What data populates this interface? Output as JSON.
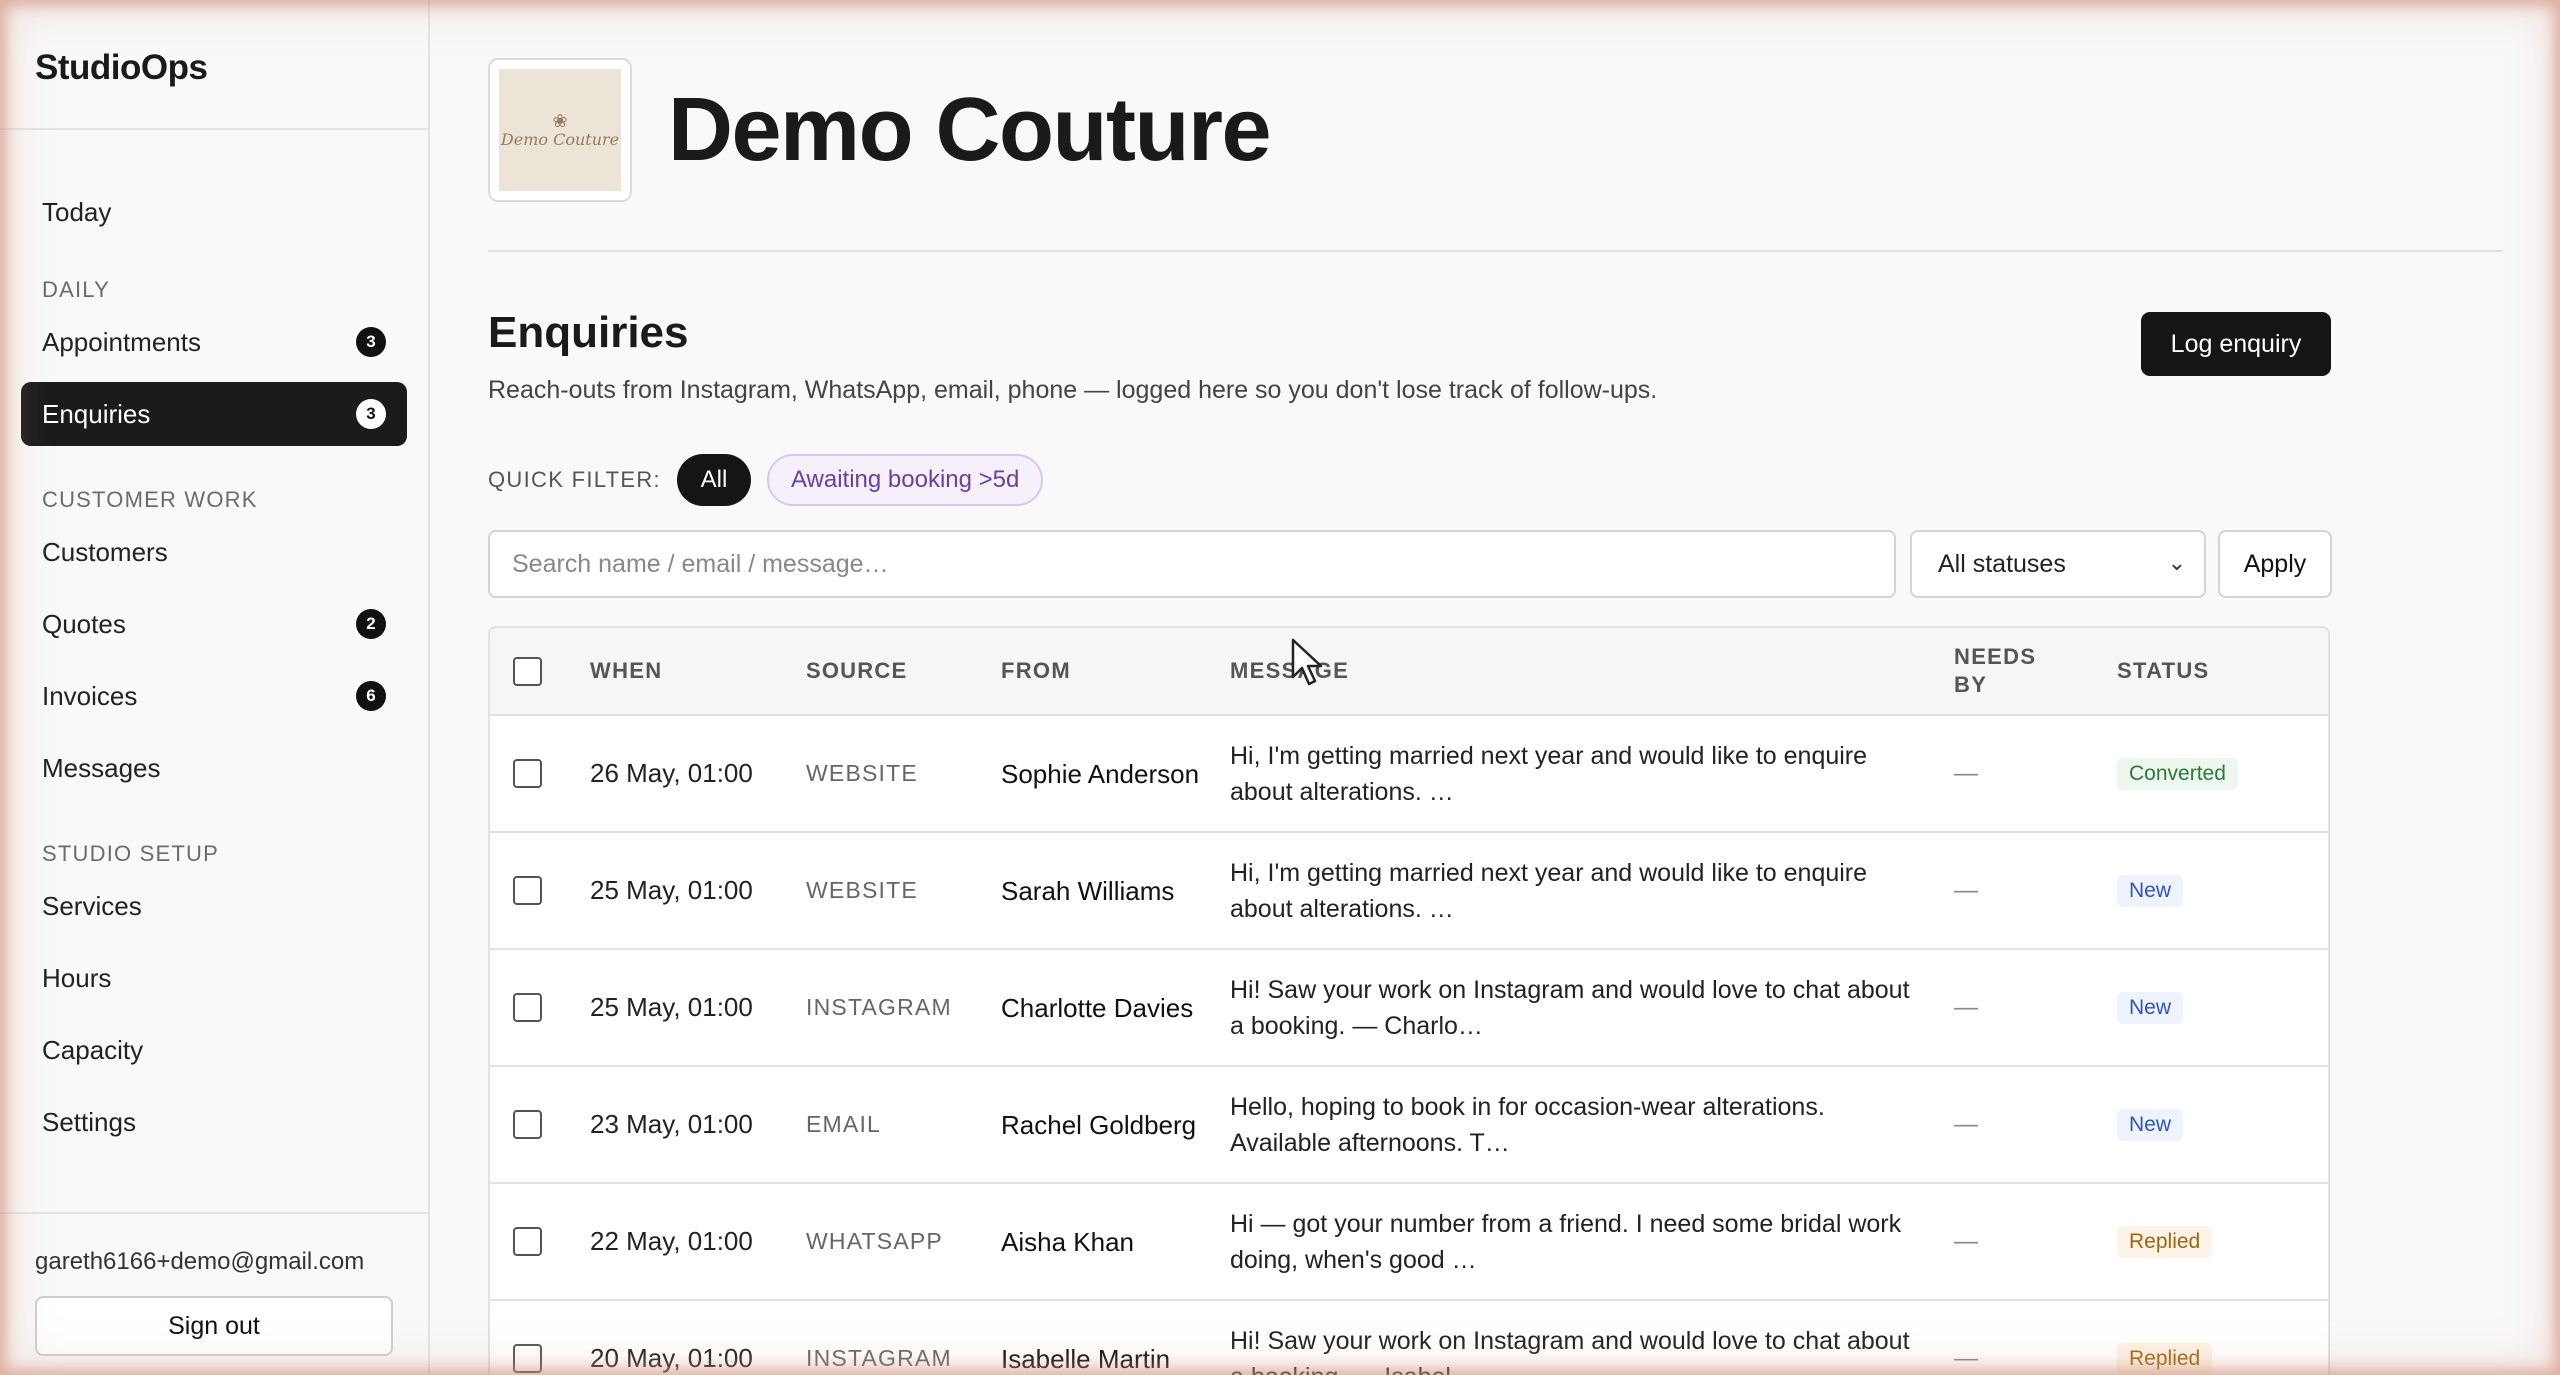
{
  "brand": "StudioOps",
  "nav": {
    "today": "Today",
    "daily_heading": "DAILY",
    "appointments": {
      "label": "Appointments",
      "badge": "3"
    },
    "enquiries": {
      "label": "Enquiries",
      "badge": "3"
    },
    "customer_work_heading": "CUSTOMER WORK",
    "customers": "Customers",
    "quotes": {
      "label": "Quotes",
      "badge": "2"
    },
    "invoices": {
      "label": "Invoices",
      "badge": "6"
    },
    "messages": "Messages",
    "studio_setup_heading": "STUDIO SETUP",
    "services": "Services",
    "hours": "Hours",
    "capacity": "Capacity",
    "settings": "Settings"
  },
  "account": {
    "email": "gareth6166+demo@gmail.com",
    "signout_label": "Sign out"
  },
  "studio": {
    "logo_text": "Demo Couture",
    "name": "Demo Couture"
  },
  "page": {
    "title": "Enquiries",
    "subtitle": "Reach-outs from Instagram, WhatsApp, email, phone — logged here so you don't lose track of follow-ups.",
    "log_button": "Log enquiry"
  },
  "quick_filter": {
    "label": "QUICK FILTER:",
    "all": "All",
    "awaiting": "Awaiting booking >5d"
  },
  "search": {
    "placeholder": "Search name / email / message…",
    "value": ""
  },
  "status_filter": {
    "selected": "All statuses"
  },
  "apply_label": "Apply",
  "table": {
    "headers": {
      "when": "WHEN",
      "source": "SOURCE",
      "from": "FROM",
      "message": "MESSAGE",
      "needs_by": "NEEDS BY",
      "status": "STATUS"
    },
    "rows": [
      {
        "when": "26 May, 01:00",
        "source": "WEBSITE",
        "from": "Sophie Anderson",
        "message": "Hi, I'm getting married next year and would like to enquire about alterations. …",
        "needs_by": "—",
        "status": "Converted",
        "status_kind": "converted"
      },
      {
        "when": "25 May, 01:00",
        "source": "WEBSITE",
        "from": "Sarah Williams",
        "message": "Hi, I'm getting married next year and would like to enquire about alterations. …",
        "needs_by": "—",
        "status": "New",
        "status_kind": "new"
      },
      {
        "when": "25 May, 01:00",
        "source": "INSTAGRAM",
        "from": "Charlotte Davies",
        "message": "Hi! Saw your work on Instagram and would love to chat about a booking. — Charlo…",
        "needs_by": "—",
        "status": "New",
        "status_kind": "new"
      },
      {
        "when": "23 May, 01:00",
        "source": "EMAIL",
        "from": "Rachel Goldberg",
        "message": "Hello, hoping to book in for occasion-wear alterations. Available afternoons. T…",
        "needs_by": "—",
        "status": "New",
        "status_kind": "new"
      },
      {
        "when": "22 May, 01:00",
        "source": "WHATSAPP",
        "from": "Aisha Khan",
        "message": "Hi — got your number from a friend. I need some bridal work doing, when's good …",
        "needs_by": "—",
        "status": "Replied",
        "status_kind": "replied"
      },
      {
        "when": "20 May, 01:00",
        "source": "INSTAGRAM",
        "from": "Isabelle Martin",
        "message": "Hi! Saw your work on Instagram and would love to chat about a booking. — Isabel…",
        "needs_by": "—",
        "status": "Replied",
        "status_kind": "replied"
      }
    ]
  },
  "colors": {
    "sidebar_active": "#1b1b1b",
    "converted": "#2a7a38",
    "new": "#2d55c4",
    "replied": "#a3640e",
    "awaiting_chip": "#6a3fa0"
  }
}
